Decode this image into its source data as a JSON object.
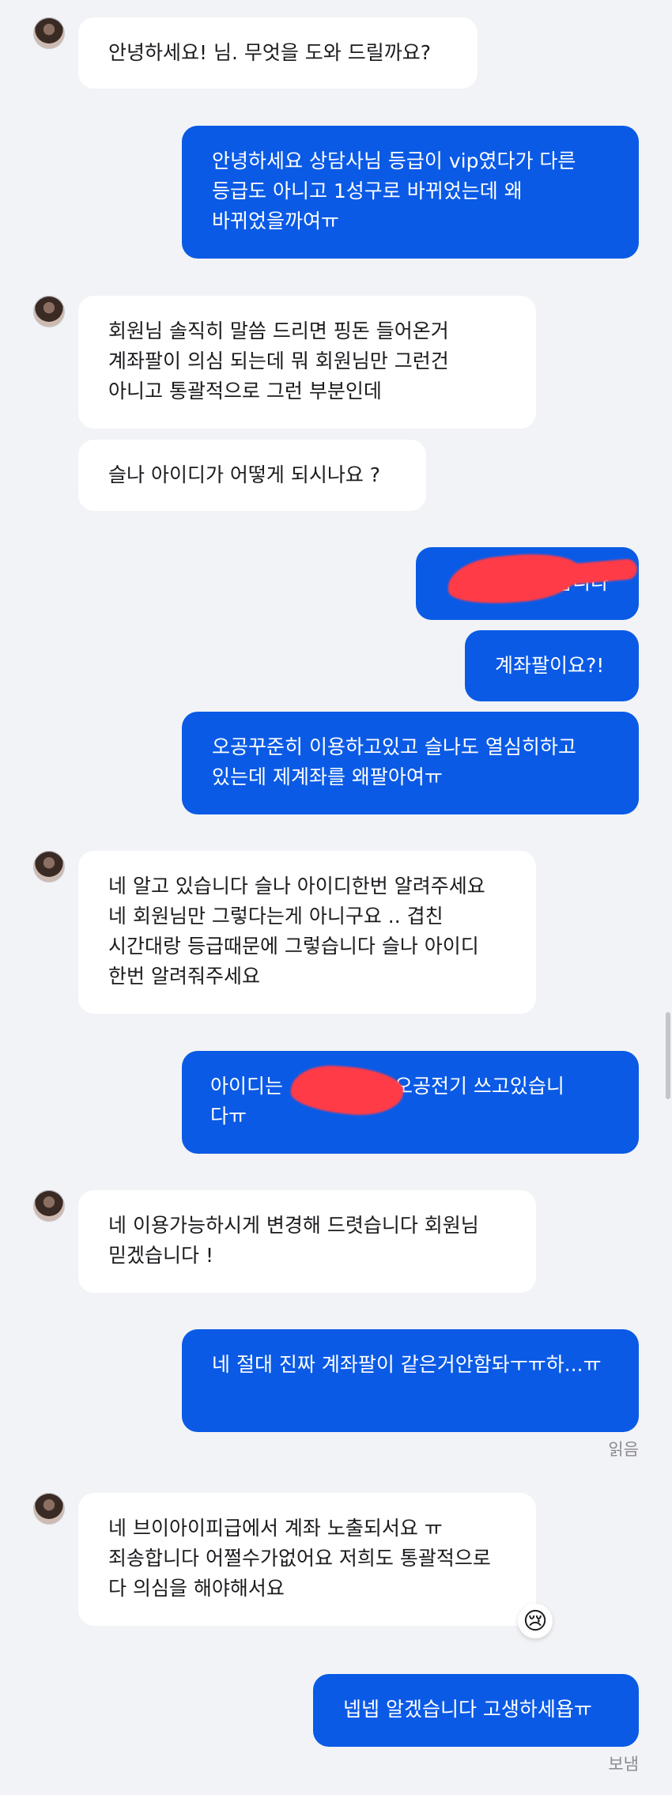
{
  "messages": [
    {
      "from": "agent",
      "text": "안녕하세요! 님. 무엇을 도와 드릴까요?"
    },
    {
      "from": "user",
      "text": "안녕하세요 상담사님 등급이 vip였다가 다른 등급도 아니고 1성구로 바뀌었는데 왜 바뀌었을까여ㅠ"
    },
    {
      "from": "agent",
      "text": "회원님 솔직히 말씀 드리면 핑돈 들어온거 계좌팔이 의심 되는데 뭐 회원님만 그런건 아니고 통괄적으로 그런 부분인데"
    },
    {
      "from": "agent",
      "text": "슬나 아이디가 어떻게 되시나요 ?"
    },
    {
      "from": "user",
      "text": "습니다"
    },
    {
      "from": "user",
      "text": "계좌팔이요?!"
    },
    {
      "from": "user",
      "text": "오공꾸준히 이용하고있고 슬나도 열심히하고 있는데 제계좌를 왜팔아여ㅠ"
    },
    {
      "from": "agent",
      "text": "네 알고 있습니다 슬나 아이디한번 알려주세요 네 회원님만 그렇다는게 아니구요 .. 겹친 시간대랑 등급때문에 그렇습니다 슬나 아이디 한번 알려줘주세요"
    },
    {
      "from": "user",
      "text_before": "아이디는",
      "text_after": "은 오공전기 쓰고있습니",
      "text_line2": "다ㅠ"
    },
    {
      "from": "agent",
      "text": "네 이용가능하시게 변경해 드렷습니다 회원님 믿겠습니다 !"
    },
    {
      "from": "user",
      "text": "네 절대 진짜 계좌팔이 같은거안함돠ㅜㅠ하...ㅠ"
    },
    {
      "from": "agent",
      "text": "네 브이아이피급에서 계좌 노출되서요 ㅠ 죄송합니다 어쩔수가없어요 저희도 통괄적으로 다 의심을 해야해서요"
    },
    {
      "from": "user",
      "text": "넵넵 알겠습니다 고생하세욥ㅠ"
    }
  ],
  "status": {
    "read": "읽음",
    "sent": "보냄"
  },
  "reaction_icon": "crying-face-icon",
  "reaction_glyph": "😢",
  "colors": {
    "user_bubble": "#0a5ae6",
    "agent_bubble": "#ffffff",
    "background": "#f2f3f6",
    "redaction": "#ff3b47"
  }
}
